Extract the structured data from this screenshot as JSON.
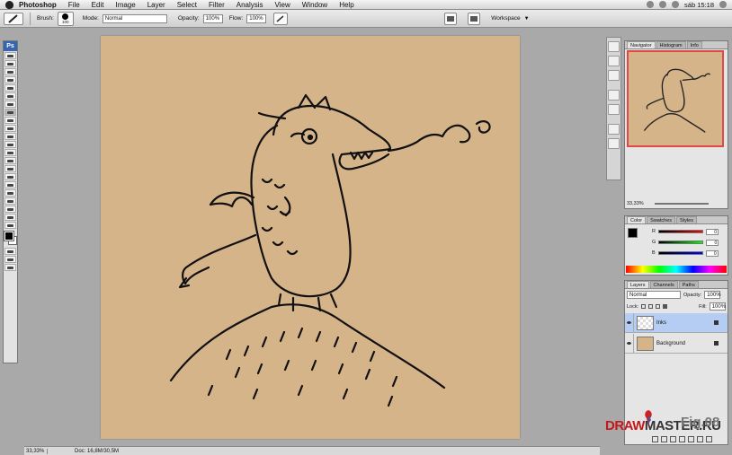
{
  "menubar": {
    "app": "Photoshop",
    "items": [
      "File",
      "Edit",
      "Image",
      "Layer",
      "Select",
      "Filter",
      "Analysis",
      "View",
      "Window",
      "Help"
    ],
    "clock": "sáb 15:18"
  },
  "options": {
    "brush_label": "Brush:",
    "brush_size": "100",
    "mode_label": "Mode:",
    "mode_value": "Normal",
    "opacity_label": "Opacity:",
    "opacity_value": "100%",
    "flow_label": "Flow:",
    "flow_value": "100%",
    "workspace_label": "Workspace"
  },
  "toolbox": {
    "logo": "Ps"
  },
  "status": {
    "zoom": "33,33%",
    "doc": "Doc: 16,8M/30,5M"
  },
  "navigator": {
    "tabs": [
      "Navigator",
      "Histogram",
      "Info"
    ],
    "zoom": "33,33%"
  },
  "color": {
    "tabs": [
      "Color",
      "Swatches",
      "Styles"
    ],
    "channels": [
      {
        "name": "R",
        "value": "0"
      },
      {
        "name": "G",
        "value": "0"
      },
      {
        "name": "B",
        "value": "0"
      }
    ]
  },
  "layers": {
    "tabs": [
      "Layers",
      "Channels",
      "Paths"
    ],
    "blend_mode": "Normal",
    "opacity_label": "Opacity:",
    "opacity_value": "100%",
    "lock_label": "Lock:",
    "fill_label": "Fill:",
    "fill_value": "100%",
    "items": [
      {
        "name": "Inks",
        "selected": true
      },
      {
        "name": "Background",
        "selected": false
      }
    ]
  },
  "watermark": {
    "a": "DRAW",
    "b": "MASTER.RU",
    "fig": "Fig.08"
  },
  "colors": {
    "paper": "#d6b489",
    "selection": "#b5cdf2",
    "nav_frame": "#e04848"
  }
}
